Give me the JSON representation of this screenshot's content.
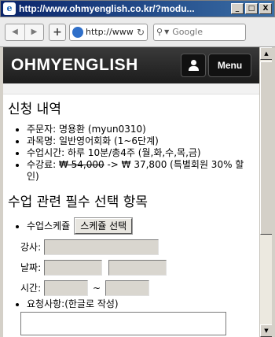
{
  "window": {
    "title": "http://www.ohmyenglish.co.kr/?modu...",
    "buttons": [
      "_",
      "□",
      "X"
    ]
  },
  "browser": {
    "url": "http://www",
    "search_placeholder": "Google"
  },
  "site": {
    "logo": "OHMYENGLISH",
    "menu_label": "Menu"
  },
  "application": {
    "heading": "신청 내역",
    "items": [
      "주문자: 명용환 (myun0310)",
      "과목명: 일반영어회화 (1~6단계)",
      "수업시간: 하루 10분/총4주 (월,화,수,목,금)"
    ],
    "fee_prefix": "수강료: ",
    "fee_original": "₩ 54,000",
    "fee_rest": " -> ₩ 37,800 (특별회원 30% 할인)"
  },
  "required": {
    "heading": "수업 관련 필수 선택 항목",
    "schedule_label": "수업스케쥴",
    "schedule_button": "스케쥴 선택",
    "teacher_label": "강사:",
    "date_label": "날짜:",
    "time_label": "시간:",
    "time_separator": "~",
    "request_label": "요청사항:(한글로 작성)"
  }
}
